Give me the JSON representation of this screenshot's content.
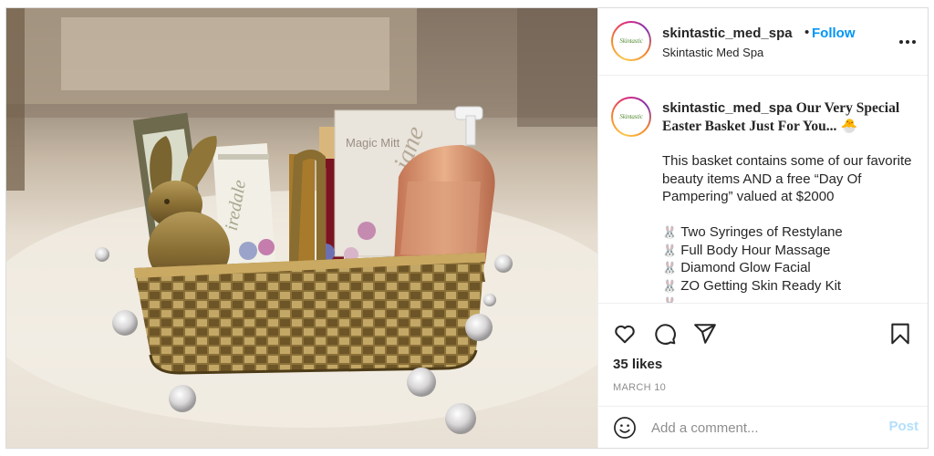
{
  "post": {
    "username": "skintastic_med_spa",
    "follow_label": "Follow",
    "location": "Skintastic Med Spa",
    "avatar_logo_text": "Skintastic",
    "image_labels": {
      "mitt": "Magic Mitt",
      "jane": "jane iredale",
      "jane_short": "iredale"
    }
  },
  "caption": {
    "username": "skintastic_med_spa",
    "title": "Our Very Special Easter Basket Just For You...",
    "title_emoji": "🐣",
    "paragraph": "This basket contains some of our favorite beauty items AND a free “Day Of Pampering” valued at $2000",
    "list_icon": "🐰",
    "items": [
      "Two Syringes of Restylane",
      "Full Body Hour Massage",
      "Diamond Glow Facial",
      "ZO Getting Skin Ready Kit",
      ""
    ]
  },
  "actions": {
    "icons": [
      "heart-icon",
      "comment-icon",
      "share-icon",
      "bookmark-icon"
    ],
    "likes": "35 likes",
    "date": "MARCH 10"
  },
  "comment": {
    "placeholder": "Add a comment...",
    "post_label": "Post"
  },
  "colors": {
    "accent": "#0095f6",
    "post_disabled": "#b2dffc",
    "text": "#262626",
    "muted": "#8e8e8e"
  }
}
